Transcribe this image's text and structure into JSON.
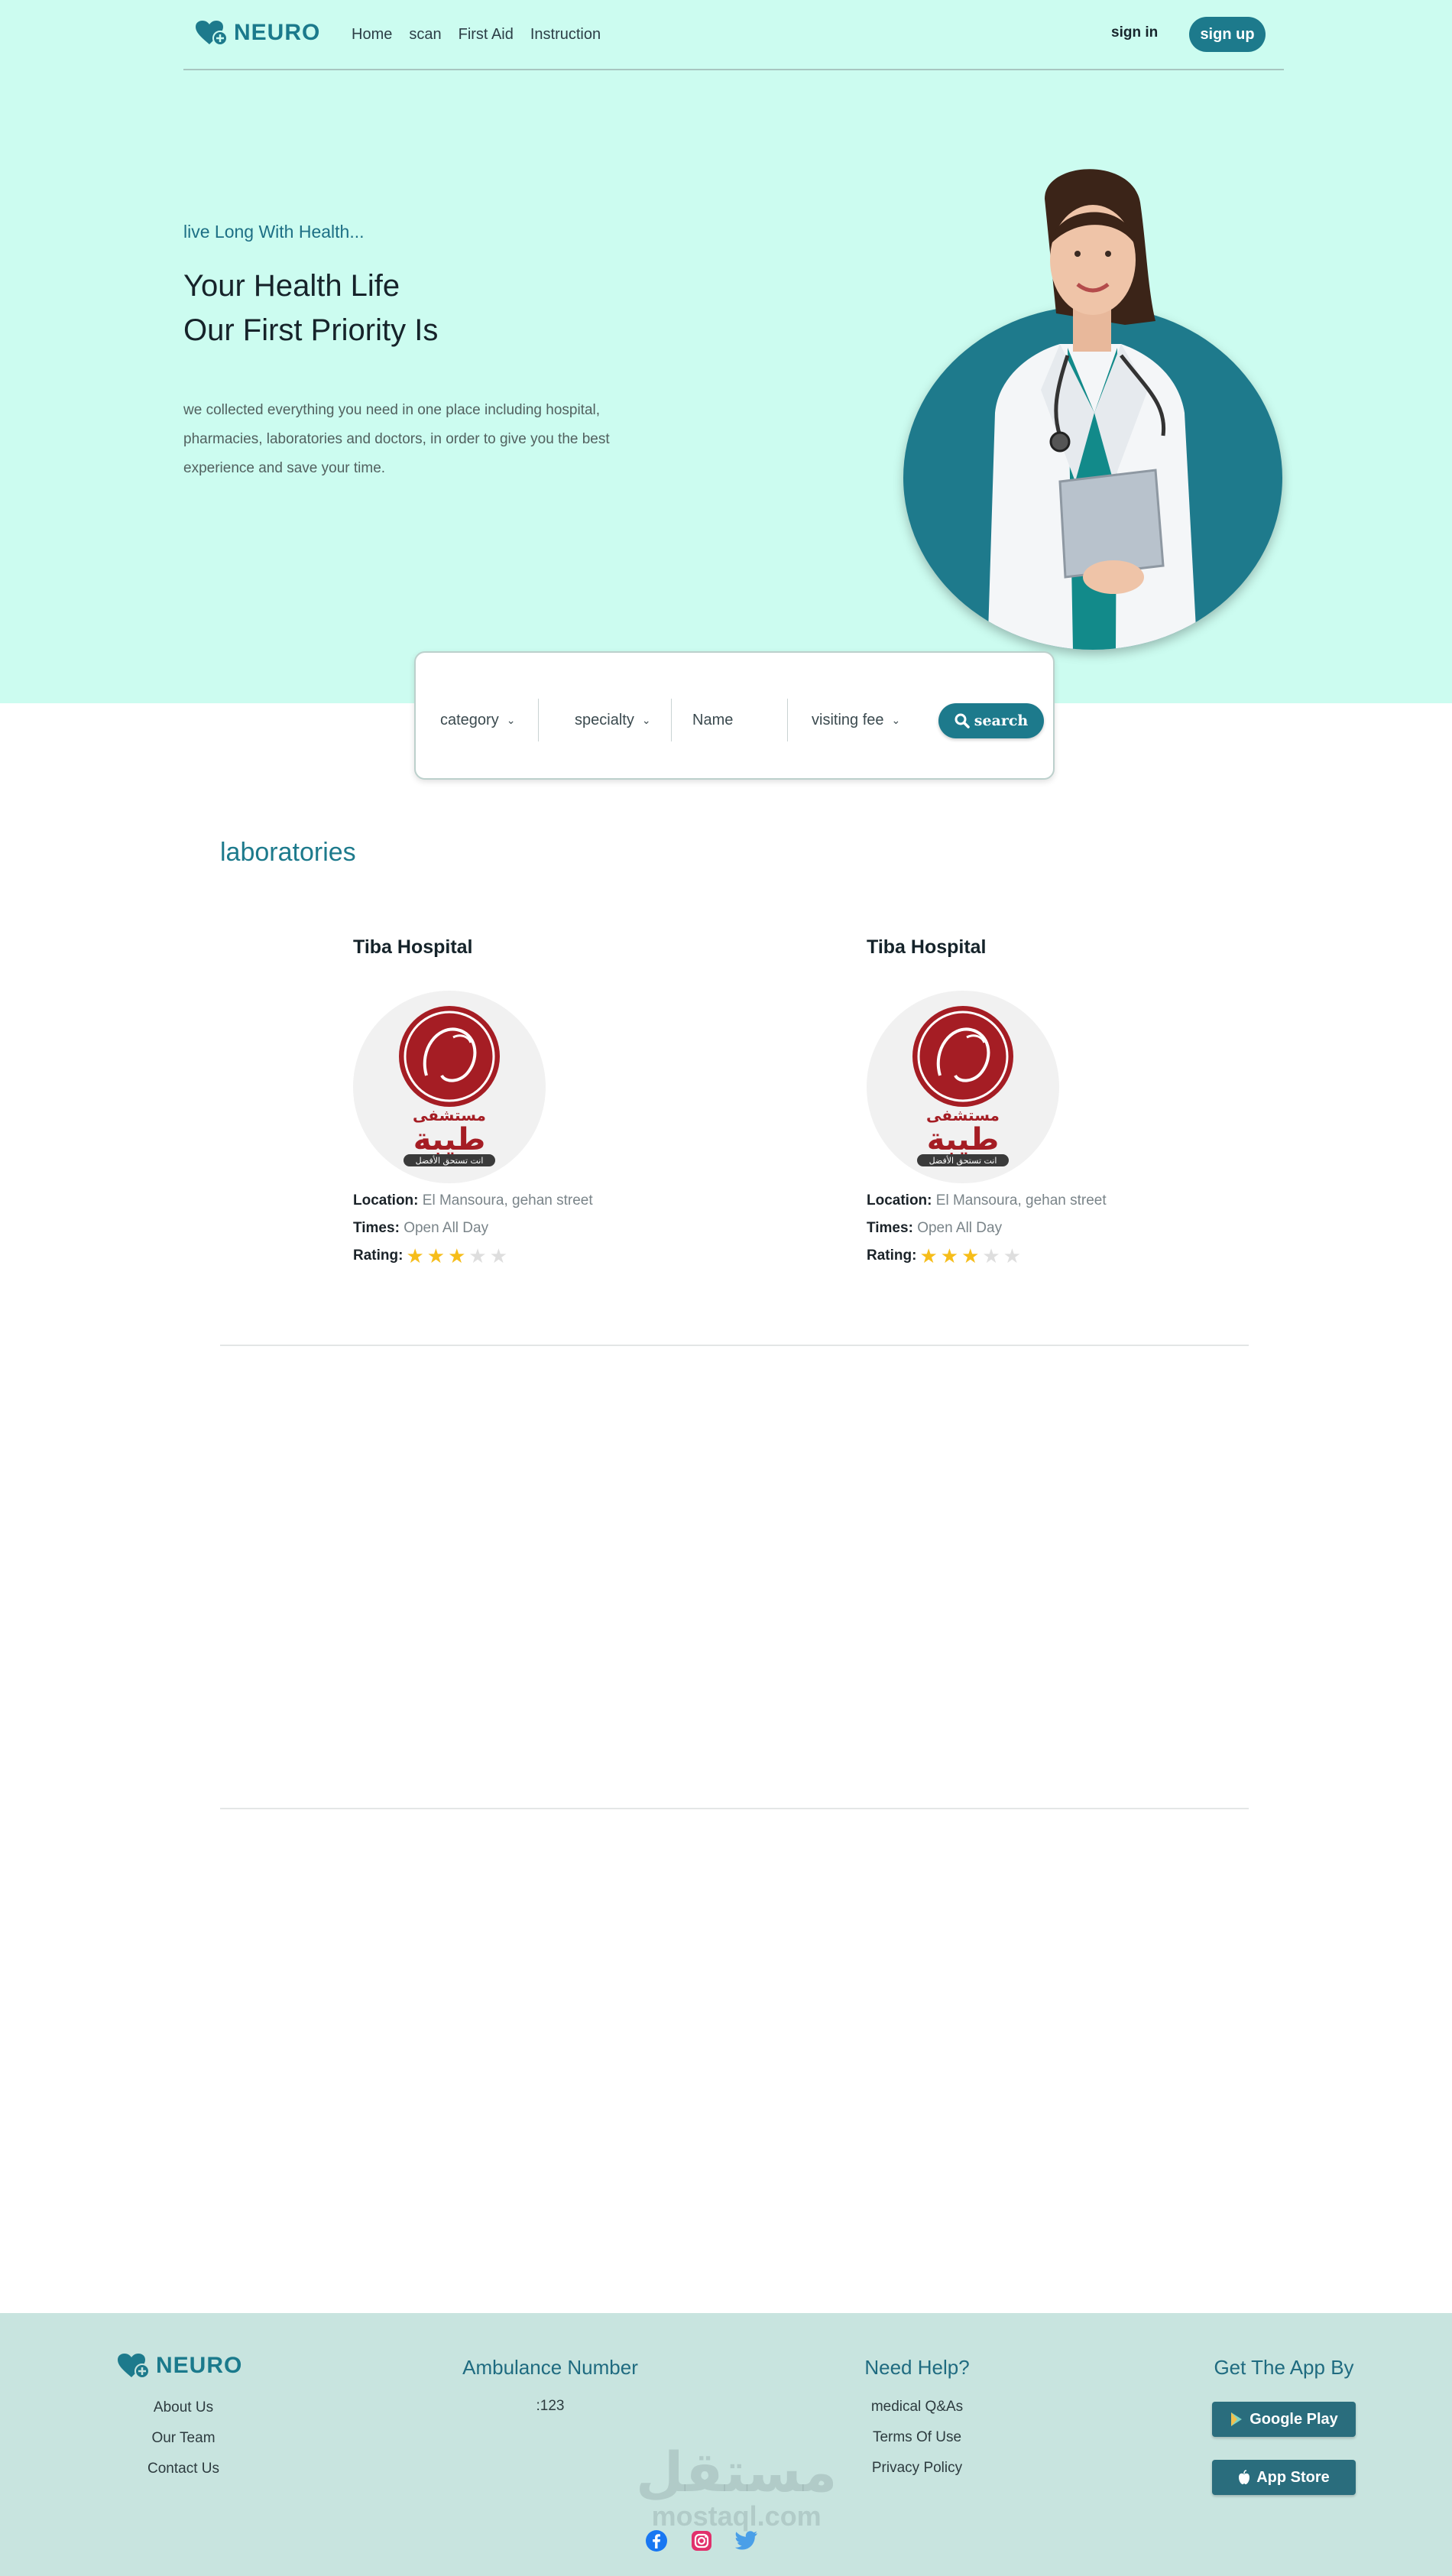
{
  "brand": {
    "name": "NEURO",
    "color": "#1d7a8c"
  },
  "nav": {
    "links": [
      "Home",
      "scan",
      "First Aid",
      "Instruction"
    ],
    "signin": "sign in",
    "signup": "sign up"
  },
  "hero": {
    "tagline": "live Long With Health...",
    "headline_line1": "Your Health Life",
    "headline_line2": "Our First Priority Is",
    "description": "we collected everything you need in one place including hospital, pharmacies, laboratories and doctors, in order to give you the best experience and save your time."
  },
  "search": {
    "category": "category",
    "specialty": "specialty",
    "name_placeholder": "Name",
    "visiting_fee": "visiting fee",
    "button": "search"
  },
  "section": {
    "title": "laboratories",
    "cards": [
      {
        "name": "Tiba Hospital",
        "logo_text_ar": "مستشفى",
        "logo_title_ar": "طيبة",
        "logo_tag_ar": "انت تستحق الأفضل",
        "location_label": "Location:",
        "location": "El Mansoura, gehan street",
        "times_label": "Times:",
        "times": "Open All Day",
        "rating_label": "Rating:",
        "rating": 3,
        "rating_max": 5
      },
      {
        "name": "Tiba Hospital",
        "logo_text_ar": "مستشفى",
        "logo_title_ar": "طيبة",
        "logo_tag_ar": "انت تستحق الأفضل",
        "location_label": "Location:",
        "location": "El Mansoura, gehan street",
        "times_label": "Times:",
        "times": "Open All Day",
        "rating_label": "Rating:",
        "rating": 3,
        "rating_max": 5
      }
    ]
  },
  "footer": {
    "links": [
      "About Us",
      "Our Team",
      "Contact Us"
    ],
    "ambulance_title": "Ambulance Number",
    "ambulance_number": ":123",
    "help_title": "Need Help?",
    "help_links": [
      "medical Q&As",
      "Terms Of Use",
      "Privacy Policy"
    ],
    "app_title": "Get The App By",
    "google_play": "Google Play",
    "app_store": "App Store",
    "watermark_ar": "مستقل",
    "watermark_en": "mostaql.com"
  },
  "colors": {
    "hero_bg": "#ccfcf0",
    "footer_bg": "#c8e4df",
    "accent": "#1d7a8c",
    "star": "#f6bd1a"
  }
}
